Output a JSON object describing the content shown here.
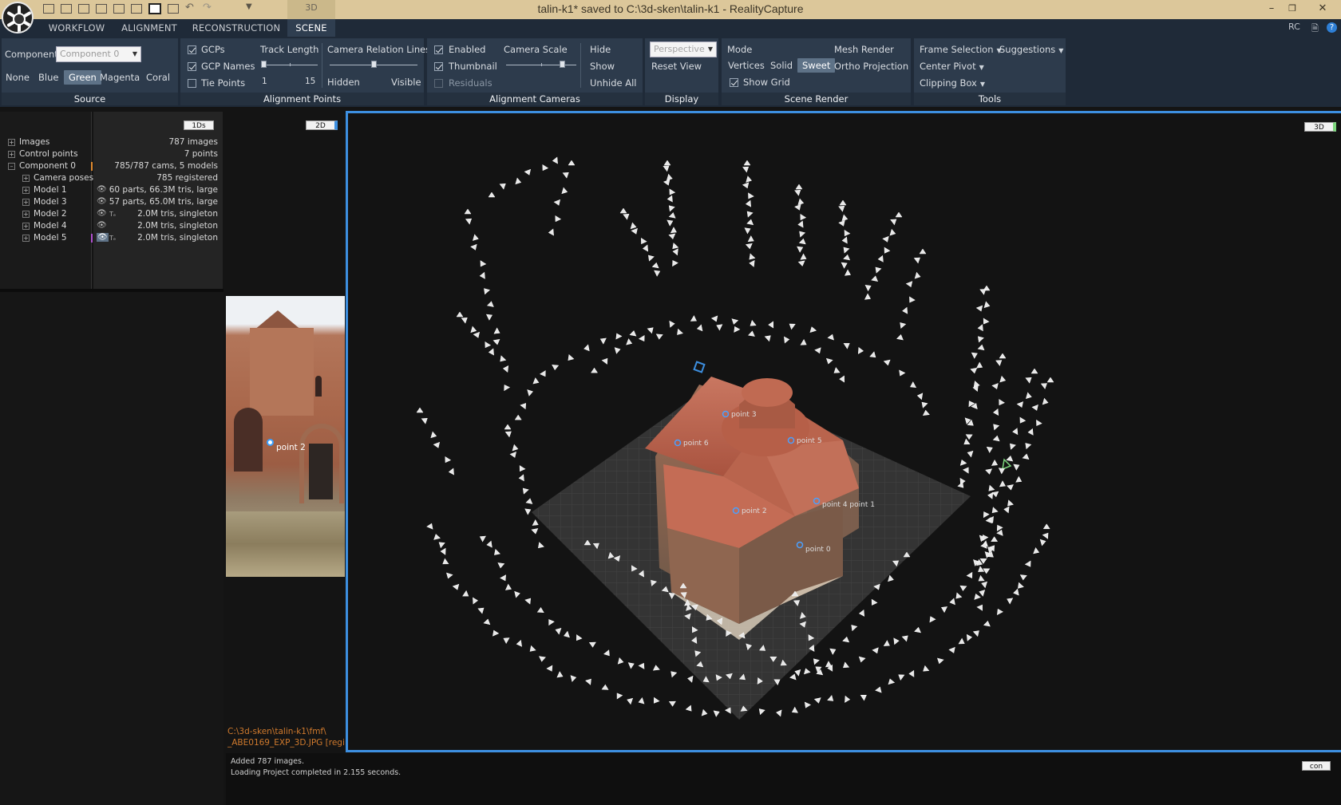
{
  "window": {
    "title": "talin-k1* saved to C:\\3d-sken\\talin-k1 - RealityCapture",
    "mode_tab": "3D",
    "minimize": "–",
    "restore": "❐",
    "close": "✕"
  },
  "menu": {
    "tabs": [
      {
        "label": "WORKFLOW"
      },
      {
        "label": "ALIGNMENT"
      },
      {
        "label": "RECONSTRUCTION"
      },
      {
        "label": "SCENE"
      }
    ],
    "active": "SCENE",
    "right": {
      "rc": "RC",
      "help": "?"
    }
  },
  "ribbon": {
    "source": {
      "label": "Source",
      "component_label": "Component",
      "component_value": "Component 0",
      "colors": [
        "None",
        "Blue",
        "Green",
        "Magenta",
        "Coral"
      ],
      "selected_color": "Green"
    },
    "alignment_points": {
      "label": "Alignment Points",
      "gcps": "GCPs",
      "gcp_names": "GCP Names",
      "tie_points": "Tie Points",
      "track_length": "Track Length",
      "track_min": "1",
      "track_max": "15",
      "relation_lines": "Camera Relation Lines",
      "hidden": "Hidden",
      "visible": "Visible"
    },
    "alignment_cameras": {
      "label": "Alignment Cameras",
      "enabled": "Enabled",
      "thumbnail": "Thumbnail",
      "residuals": "Residuals",
      "camera_scale": "Camera Scale",
      "hide": "Hide",
      "show": "Show",
      "unhide_all": "Unhide All"
    },
    "display": {
      "label": "Display",
      "projection_placeholder": "Perspective",
      "reset_view": "Reset View"
    },
    "scene_render": {
      "label": "Scene Render",
      "mode": "Mode",
      "mesh_render": "Mesh Render",
      "vertices": "Vertices",
      "solid": "Solid",
      "sweet": "Sweet",
      "ortho": "Ortho Projection",
      "show_grid": "Show Grid"
    },
    "tools": {
      "label": "Tools",
      "frame_selection": "Frame Selection",
      "suggestions": "Suggestions",
      "center_pivot": "Center Pivot",
      "clipping_box": "Clipping Box"
    }
  },
  "tree": {
    "badge": "1Ds",
    "items": [
      {
        "label": "Images",
        "info": "787 images"
      },
      {
        "label": "Control points",
        "info": "7 points"
      },
      {
        "label": "Component 0",
        "info": "785/787 cams, 5 models"
      },
      {
        "label": "Camera poses",
        "info": "785 registered"
      },
      {
        "label": "Model 1",
        "info": "60 parts, 66.3M tris, large"
      },
      {
        "label": "Model 3",
        "info": "57 parts, 65.0M tris, large"
      },
      {
        "label": "Model 2",
        "info": "2.0M tris, singleton"
      },
      {
        "label": "Model 4",
        "info": "2.0M tris, singleton"
      },
      {
        "label": "Model 5",
        "info": "2.0M tris, singleton"
      }
    ],
    "tex_marker": "Tₑ"
  },
  "view2d": {
    "badge": "2D",
    "point_label": "point 2",
    "path_line1": "C:\\3d-sken\\talin-k1\\fmf\\",
    "path_line2": "_ABE0169_EXP_3D.JPG [regis"
  },
  "view3d": {
    "badge": "3D",
    "points": [
      {
        "label": "point 3"
      },
      {
        "label": "point 6"
      },
      {
        "label": "point 5"
      },
      {
        "label": "point 2"
      },
      {
        "label": "point 4 point 1"
      },
      {
        "label": "point 0"
      }
    ]
  },
  "console": {
    "badge": "con",
    "lines": [
      "Added 787 images.",
      "Loading Project completed in 2.155 seconds."
    ]
  },
  "colors": {
    "accent_blue": "#3d8fe0",
    "ribbon_bg": "#2d3b4c",
    "title_bar": "#dcc79a",
    "selected_btn": "#5e7287",
    "roof": "#b8624c"
  }
}
